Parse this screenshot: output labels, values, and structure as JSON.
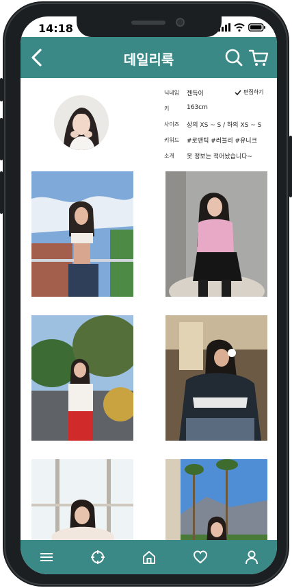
{
  "status": {
    "time": "14:18"
  },
  "header": {
    "title": "데일리룩",
    "back_icon": "back-chevron-icon",
    "search_icon": "search-icon",
    "cart_icon": "cart-icon"
  },
  "profile": {
    "edit_label": "편집하기",
    "rows": [
      {
        "label": "닉네임",
        "value": "젠득이"
      },
      {
        "label": "키",
        "value": "163cm"
      },
      {
        "label": "사이즈",
        "value": "상의 XS ~ S / 하의 XS ~ S"
      },
      {
        "label": "키워드",
        "value": "#로맨틱 #러블리 #유니크"
      },
      {
        "label": "소개",
        "value": "옷 정보는 적어놨습니다~"
      }
    ]
  },
  "tabbar": {
    "icons": [
      "menu-icon",
      "explore-icon",
      "home-icon",
      "heart-icon",
      "user-icon"
    ]
  },
  "colors": {
    "accent": "#3a8987"
  }
}
